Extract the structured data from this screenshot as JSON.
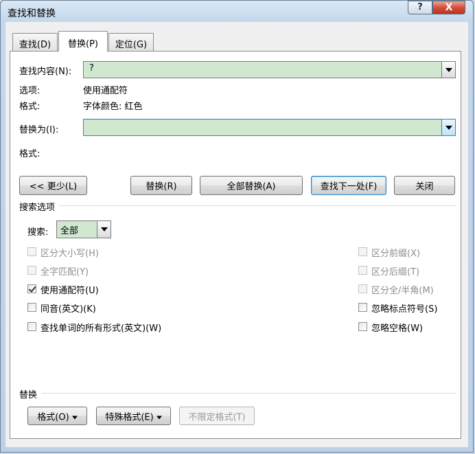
{
  "window": {
    "title": "查找和替换",
    "help_label": "?",
    "close_label": "X"
  },
  "tabs": [
    {
      "label": "查找(D)"
    },
    {
      "label": "替换(P)"
    },
    {
      "label": "定位(G)"
    }
  ],
  "find": {
    "label": "查找内容(N):",
    "value": "?",
    "options_label": "选项:",
    "options_value": "使用通配符",
    "format_label": "格式:",
    "format_value": "字体颜色: 红色"
  },
  "replace": {
    "label": "替换为(I):",
    "value": "",
    "format_label": "格式:"
  },
  "buttons": {
    "less": "<< 更少(L)",
    "replace": "替换(R)",
    "replace_all": "全部替换(A)",
    "find_next": "查找下一处(F)",
    "close": "关闭"
  },
  "search_options": {
    "title": "搜索选项",
    "search_label": "搜索:",
    "search_value": "全部"
  },
  "checkboxes_left": [
    {
      "label": "区分大小写(H)",
      "checked": false,
      "disabled": true
    },
    {
      "label": "全字匹配(Y)",
      "checked": false,
      "disabled": true
    },
    {
      "label": "使用通配符(U)",
      "checked": true,
      "disabled": false
    },
    {
      "label": "同音(英文)(K)",
      "checked": false,
      "disabled": false
    },
    {
      "label": "查找单词的所有形式(英文)(W)",
      "checked": false,
      "disabled": false
    }
  ],
  "checkboxes_right": [
    {
      "label": "区分前缀(X)",
      "checked": false,
      "disabled": true
    },
    {
      "label": "区分后缀(T)",
      "checked": false,
      "disabled": true
    },
    {
      "label": "区分全/半角(M)",
      "checked": false,
      "disabled": true
    },
    {
      "label": "忽略标点符号(S)",
      "checked": false,
      "disabled": false
    },
    {
      "label": "忽略空格(W)",
      "checked": false,
      "disabled": false
    }
  ],
  "replace_section": {
    "title": "替换",
    "format_button": "格式(O)",
    "special_button": "特殊格式(E)",
    "no_format_button": "不限定格式(T)"
  }
}
